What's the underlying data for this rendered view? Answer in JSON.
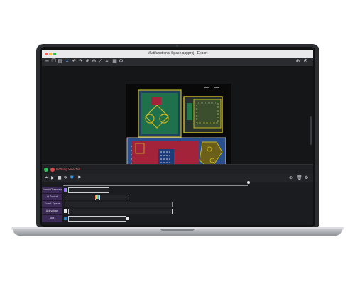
{
  "window": {
    "title": "Multifunctional Space.appproj - Export"
  },
  "toolbar": {
    "icons": [
      "menu-icon",
      "layers-icon",
      "document-icon",
      "select-icon",
      "undo-icon",
      "redo-icon",
      "zoom-in-icon",
      "zoom-out-icon",
      "fit-icon",
      "crop-icon",
      "grid-icon",
      "settings-icon"
    ],
    "right_icons": [
      "add-icon",
      "gear-icon"
    ]
  },
  "status": {
    "message": "Nothing Selected"
  },
  "timeline": {
    "rows": [
      {
        "label": "Event Channels"
      },
      {
        "label": "Q Sched"
      },
      {
        "label": "Event Space"
      },
      {
        "label": "Activation"
      },
      {
        "label": "Act"
      }
    ]
  },
  "colors": {
    "accent": "#3d8fd8",
    "board_green": "#1f7a49",
    "board_yellow": "#c8b422",
    "board_red": "#a3243a",
    "board_blue": "#2a4f8e",
    "row_label_bg": "#3a2a55"
  }
}
